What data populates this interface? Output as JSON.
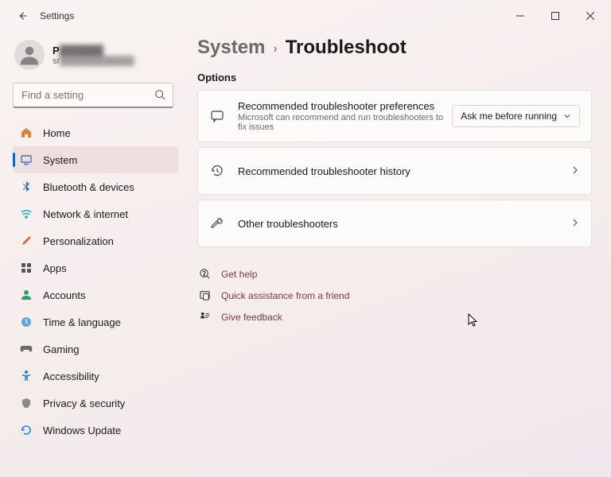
{
  "window": {
    "title": "Settings"
  },
  "user": {
    "name": "P",
    "email": "sr"
  },
  "search": {
    "placeholder": "Find a setting"
  },
  "sidebar": {
    "items": [
      {
        "label": "Home"
      },
      {
        "label": "System"
      },
      {
        "label": "Bluetooth & devices"
      },
      {
        "label": "Network & internet"
      },
      {
        "label": "Personalization"
      },
      {
        "label": "Apps"
      },
      {
        "label": "Accounts"
      },
      {
        "label": "Time & language"
      },
      {
        "label": "Gaming"
      },
      {
        "label": "Accessibility"
      },
      {
        "label": "Privacy & security"
      },
      {
        "label": "Windows Update"
      }
    ]
  },
  "breadcrumb": {
    "parent": "System",
    "current": "Troubleshoot"
  },
  "section": {
    "options_title": "Options"
  },
  "prefs": {
    "title": "Recommended troubleshooter preferences",
    "desc": "Microsoft can recommend and run troubleshooters to fix issues",
    "selected": "Ask me before running"
  },
  "history": {
    "title": "Recommended troubleshooter history"
  },
  "other": {
    "title": "Other troubleshooters"
  },
  "links": {
    "help": "Get help",
    "quick": "Quick assistance from a friend",
    "feedback": "Give feedback"
  }
}
